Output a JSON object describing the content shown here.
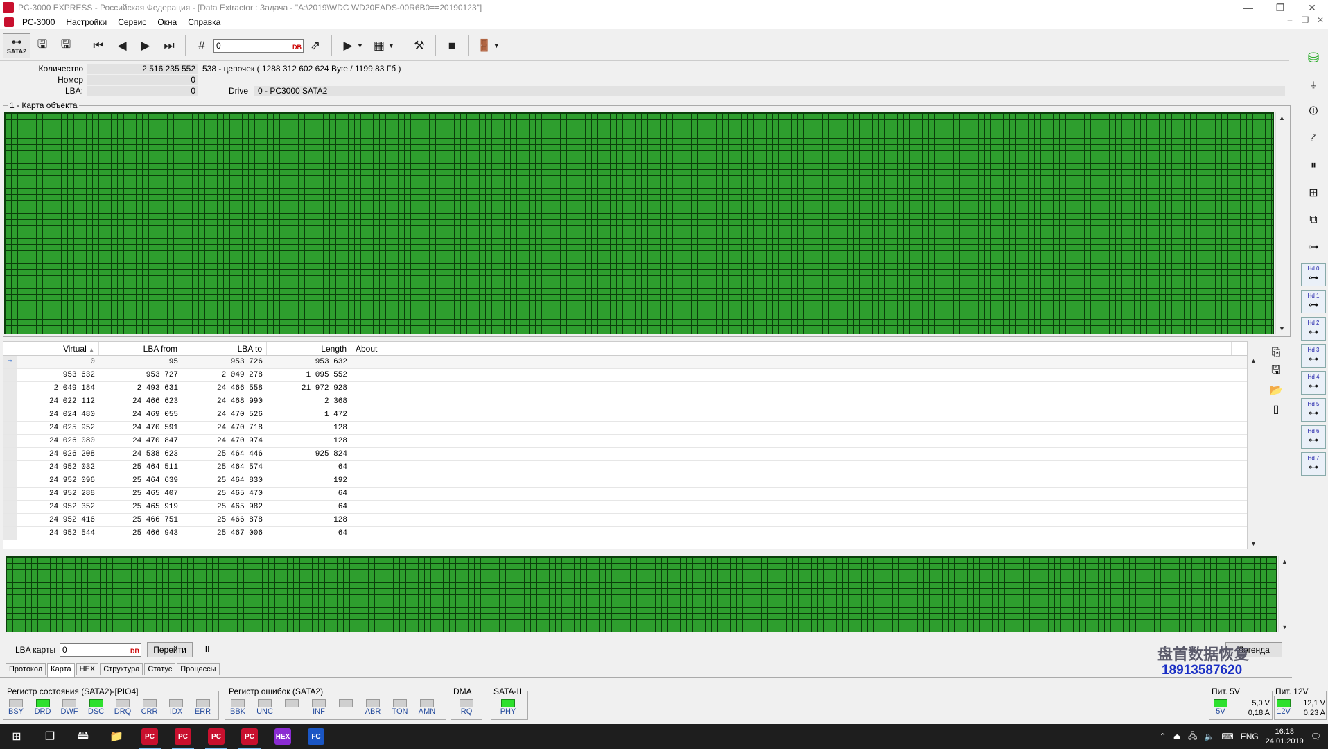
{
  "window": {
    "title": "PC-3000 EXPRESS - Российская Федерация - [Data Extractor : Задача - \"A:\\2019\\WDC WD20EADS-00R6B0==20190123\"]",
    "min": "—",
    "restore": "❐",
    "close": "✕"
  },
  "menu": [
    "PC-3000",
    "Настройки",
    "Сервис",
    "Окна",
    "Справка"
  ],
  "mdi": [
    "–",
    "❐",
    "✕"
  ],
  "toolbar": {
    "sata_label": "SATA2",
    "lba_value": "0",
    "db": "DB"
  },
  "info": {
    "count_label": "Количество",
    "count_value": "2 516 235 552",
    "count_extra": "538 - цепочек  ( 1288 312 602 624 Byte /  1199,83 Гб )",
    "number_label": "Номер",
    "number_value": "0",
    "lba_label": "LBA:",
    "lba_value": "0",
    "drive_label": "Drive",
    "drive_value": "0 - PC3000 SATA2"
  },
  "map": {
    "title": "1 - Карта объекта"
  },
  "table": {
    "headers": [
      "Virtual",
      "LBA from",
      "LBA to",
      "Length",
      "About"
    ],
    "rows": [
      [
        "0",
        "95",
        "953 726",
        "953 632"
      ],
      [
        "953 632",
        "953 727",
        "2 049 278",
        "1 095 552"
      ],
      [
        "2 049 184",
        "2 493 631",
        "24 466 558",
        "21 972 928"
      ],
      [
        "24 022 112",
        "24 466 623",
        "24 468 990",
        "2 368"
      ],
      [
        "24 024 480",
        "24 469 055",
        "24 470 526",
        "1 472"
      ],
      [
        "24 025 952",
        "24 470 591",
        "24 470 718",
        "128"
      ],
      [
        "24 026 080",
        "24 470 847",
        "24 470 974",
        "128"
      ],
      [
        "24 026 208",
        "24 538 623",
        "25 464 446",
        "925 824"
      ],
      [
        "24 952 032",
        "25 464 511",
        "25 464 574",
        "64"
      ],
      [
        "24 952 096",
        "25 464 639",
        "25 464 830",
        "192"
      ],
      [
        "24 952 288",
        "25 465 407",
        "25 465 470",
        "64"
      ],
      [
        "24 952 352",
        "25 465 919",
        "25 465 982",
        "64"
      ],
      [
        "24 952 416",
        "25 466 751",
        "25 466 878",
        "128"
      ],
      [
        "24 952 544",
        "25 466 943",
        "25 467 006",
        "64"
      ]
    ]
  },
  "controls": {
    "lba_map_label": "LBA карты",
    "lba_map_value": "0",
    "goto": "Перейти",
    "legend": "Легенда",
    "pause": "II"
  },
  "tabs": [
    "Протокол",
    "Карта",
    "HEX",
    "Структура",
    "Статус",
    "Процессы"
  ],
  "registers": {
    "status_title": "Регистр состояния (SATA2)-[PIO4]",
    "status": [
      {
        "n": "BSY",
        "on": false
      },
      {
        "n": "DRD",
        "on": true
      },
      {
        "n": "DWF",
        "on": false
      },
      {
        "n": "DSC",
        "on": true
      },
      {
        "n": "DRQ",
        "on": false
      },
      {
        "n": "CRR",
        "on": false
      },
      {
        "n": "IDX",
        "on": false
      },
      {
        "n": "ERR",
        "on": false
      }
    ],
    "error_title": "Регистр ошибок  (SATA2)",
    "error": [
      {
        "n": "BBK",
        "on": false
      },
      {
        "n": "UNC",
        "on": false
      },
      {
        "n": "",
        "on": false
      },
      {
        "n": "INF",
        "on": false
      },
      {
        "n": "",
        "on": false
      },
      {
        "n": "ABR",
        "on": false
      },
      {
        "n": "TON",
        "on": false
      },
      {
        "n": "AMN",
        "on": false
      }
    ],
    "dma_title": "DMA",
    "dma": [
      {
        "n": "RQ",
        "on": false
      }
    ],
    "sata_title": "SATA-II",
    "sata": [
      {
        "n": "PHY",
        "on": true
      }
    ]
  },
  "power": {
    "p5_title": "Пит. 5V",
    "p5_led": "5V",
    "p5_v": "5,0 V",
    "p5_a": "0,18 A",
    "p12_title": "Пит. 12V",
    "p12_led": "12V",
    "p12_v": "12,1 V",
    "p12_a": "0,23 A"
  },
  "hd": [
    "Hd 0",
    "Hd 1",
    "Hd 2",
    "Hd 3",
    "Hd 4",
    "Hd 5",
    "Hd 6",
    "Hd 7"
  ],
  "watermark": {
    "line1": "盘首数据恢复",
    "line2": "18913587620"
  },
  "taskbar": {
    "lang": "ENG",
    "time": "16:18",
    "date": "24.01.2019",
    "pc": "PC",
    "hex": "HEX",
    "fc": "FC"
  }
}
